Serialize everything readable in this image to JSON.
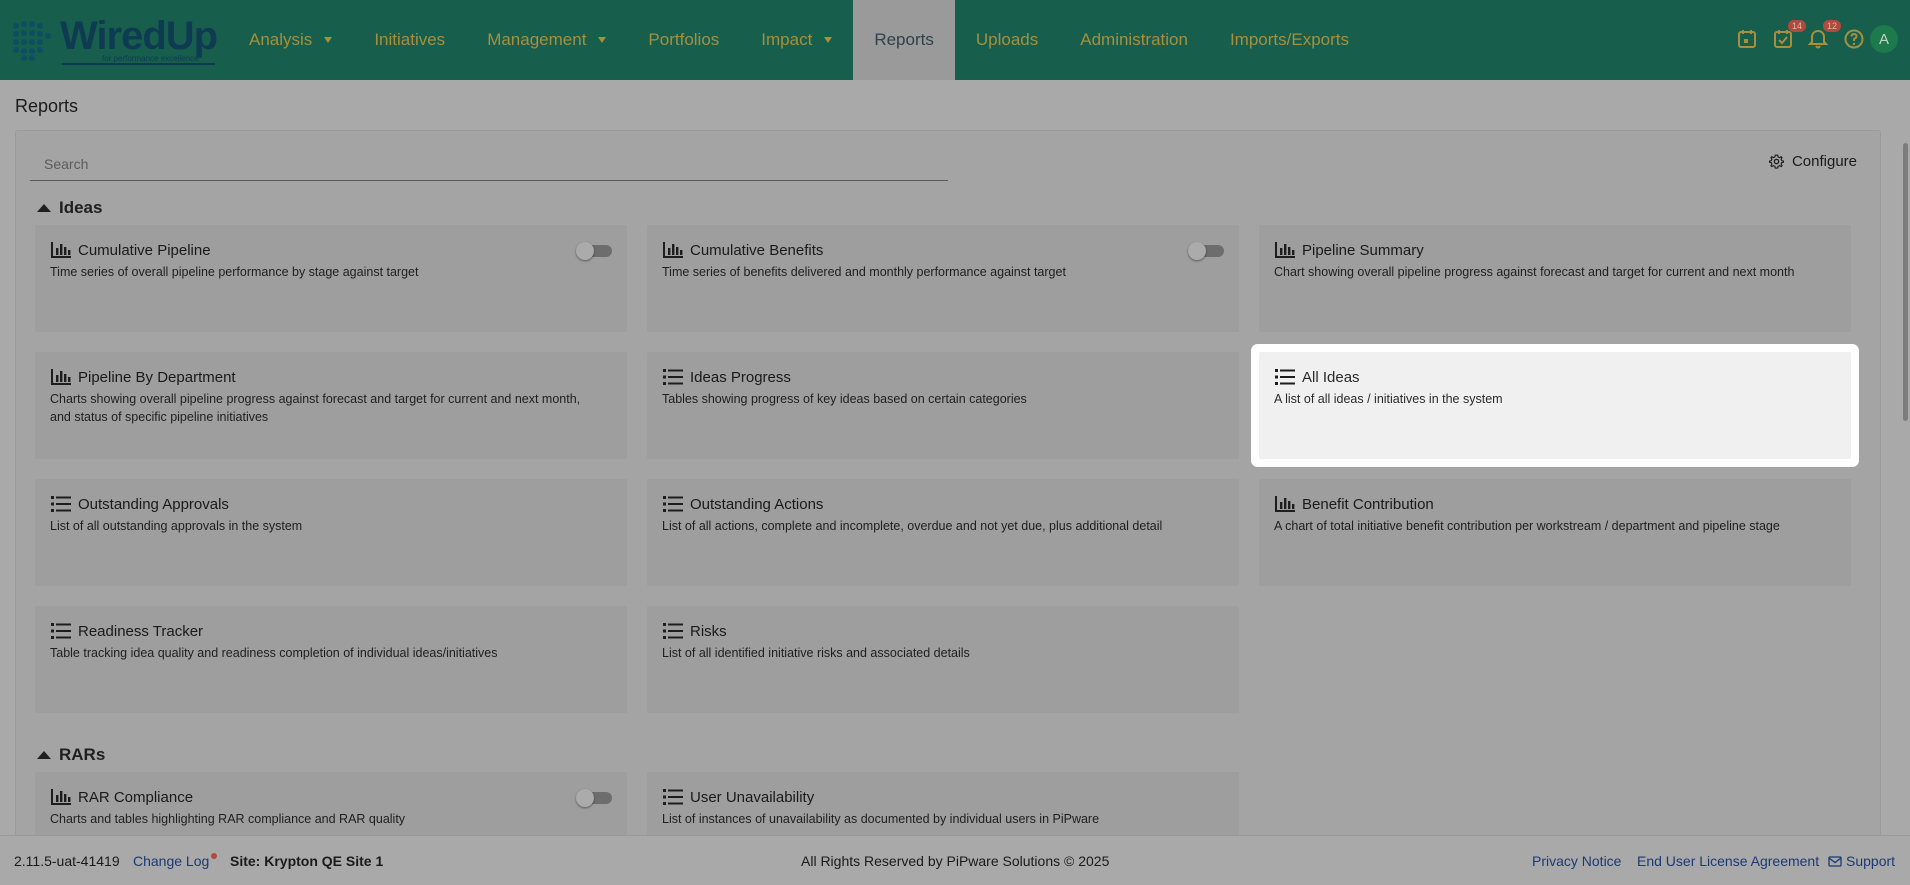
{
  "brand": {
    "name": "WiredUp",
    "tagline": "for performance excellence"
  },
  "nav": {
    "items": [
      {
        "label": "Analysis",
        "dropdown": true,
        "active": false
      },
      {
        "label": "Initiatives",
        "dropdown": false,
        "active": false
      },
      {
        "label": "Management",
        "dropdown": true,
        "active": false
      },
      {
        "label": "Portfolios",
        "dropdown": false,
        "active": false
      },
      {
        "label": "Impact",
        "dropdown": true,
        "active": false
      },
      {
        "label": "Reports",
        "dropdown": false,
        "active": true
      },
      {
        "label": "Uploads",
        "dropdown": false,
        "active": false
      },
      {
        "label": "Administration",
        "dropdown": false,
        "active": false
      },
      {
        "label": "Imports/Exports",
        "dropdown": false,
        "active": false
      }
    ],
    "icons": {
      "calendar": "calendar-icon",
      "tasks": {
        "icon": "task-check-icon",
        "badge": "14"
      },
      "notifications": {
        "icon": "bell-icon",
        "badge": "12"
      },
      "help": "help-icon",
      "avatar": "A"
    }
  },
  "page": {
    "title": "Reports"
  },
  "search": {
    "placeholder": "Search",
    "value": ""
  },
  "configure": {
    "label": "Configure",
    "icon": "gear-icon"
  },
  "sections": {
    "ideas": {
      "title": "Ideas",
      "cards": [
        {
          "title": "Cumulative Pipeline",
          "icon": "chart-icon",
          "desc": "Time series of overall pipeline performance by stage against target",
          "toggle": false
        },
        {
          "title": "Cumulative Benefits",
          "icon": "chart-icon",
          "desc": "Time series of benefits delivered and monthly performance against target",
          "toggle": false
        },
        {
          "title": "Pipeline Summary",
          "icon": "chart-icon",
          "desc": "Chart showing overall pipeline progress against forecast and target for current and next month"
        },
        {
          "title": "Pipeline By Department",
          "icon": "chart-icon",
          "desc": "Charts showing overall pipeline progress against forecast and target for current and next month, and status of specific pipeline initiatives"
        },
        {
          "title": "Ideas Progress",
          "icon": "list-icon",
          "desc": "Tables showing progress of key ideas based on certain categories"
        },
        {
          "title": "All Ideas",
          "icon": "list-icon",
          "desc": "A list of all ideas / initiatives in the system"
        },
        {
          "title": "Outstanding Approvals",
          "icon": "list-icon",
          "desc": "List of all outstanding approvals in the system"
        },
        {
          "title": "Outstanding Actions",
          "icon": "list-icon",
          "desc": "List of all actions, complete and incomplete, overdue and not yet due, plus additional detail"
        },
        {
          "title": "Benefit Contribution",
          "icon": "chart-icon",
          "desc": "A chart of total initiative benefit contribution per workstream / department and pipeline stage"
        },
        {
          "title": "Readiness Tracker",
          "icon": "list-icon",
          "desc": "Table tracking idea quality and readiness completion of individual ideas/initiatives"
        },
        {
          "title": "Risks",
          "icon": "list-icon",
          "desc": "List of all identified initiative risks and associated details"
        }
      ]
    },
    "rars": {
      "title": "RARs",
      "cards": [
        {
          "title": "RAR Compliance",
          "icon": "chart-icon",
          "desc": "Charts and tables highlighting RAR compliance and RAR quality",
          "toggle": false
        },
        {
          "title": "User Unavailability",
          "icon": "list-icon",
          "desc": "List of instances of unavailability as documented by individual users in PiPware"
        }
      ]
    }
  },
  "footer": {
    "version": "2.11.5-uat-41419",
    "changelog": "Change Log",
    "site": "Site: Krypton QE Site 1",
    "copyright": "All Rights Reserved by PiPware Solutions © 2025",
    "privacy": "Privacy Notice",
    "eula": "End User License Agreement",
    "support": "Support"
  },
  "colors": {
    "header": "#175e4c",
    "nav_text": "#a4903f",
    "overlay": "#a9a9a9",
    "link": "#1c3a72",
    "badge": "#b14a3e"
  }
}
